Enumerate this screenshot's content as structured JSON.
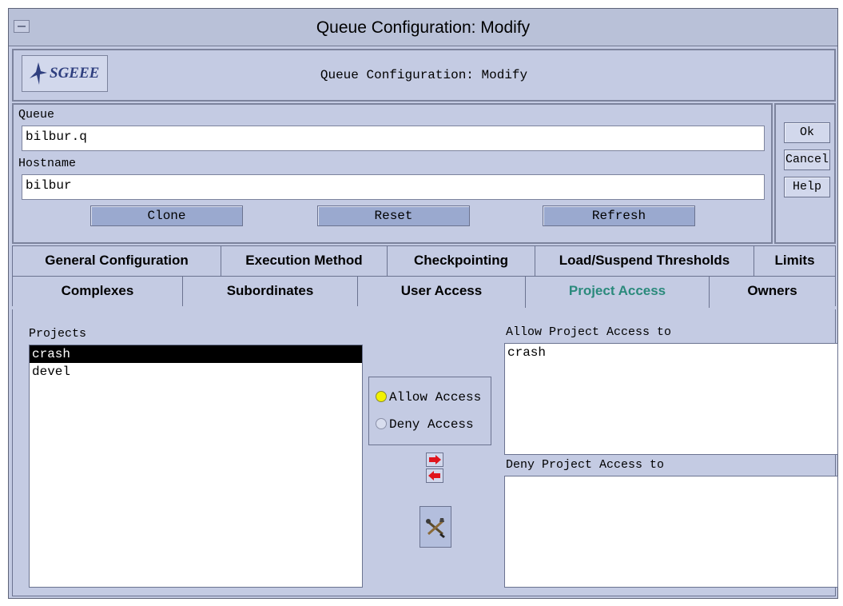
{
  "window": {
    "title": "Queue Configuration: Modify"
  },
  "header": {
    "logo_text": "SGEEE",
    "subtitle": "Queue Configuration: Modify"
  },
  "form": {
    "queue_label": "Queue",
    "queue_value": "bilbur.q",
    "hostname_label": "Hostname",
    "hostname_value": "bilbur",
    "clone_label": "Clone",
    "reset_label": "Reset",
    "refresh_label": "Refresh"
  },
  "side_buttons": {
    "ok": "Ok",
    "cancel": "Cancel",
    "help": "Help"
  },
  "tabs_row1": [
    "General Configuration",
    "Execution Method",
    "Checkpointing",
    "Load/Suspend Thresholds",
    "Limits"
  ],
  "tabs_row2": [
    "Complexes",
    "Subordinates",
    "User Access",
    "Project Access",
    "Owners"
  ],
  "active_tab": "Project Access",
  "project_access": {
    "projects_label": "Projects",
    "projects": [
      "crash",
      "devel"
    ],
    "selected_project": "crash",
    "allow_label": "Allow Access",
    "deny_label": "Deny Access",
    "allow_selected": true,
    "allow_list_label": "Allow Project Access to",
    "allow_list": [
      "crash"
    ],
    "deny_list_label": "Deny Project Access to",
    "deny_list": []
  },
  "colors": {
    "background": "#c4cbe3",
    "active_tab_text": "#2b8a7c",
    "radio_on": "#f2f200",
    "arrow": "#e0141c"
  },
  "icons": {
    "menu": "window-menu-icon",
    "logo": "bird-logo-icon",
    "add": "arrow-right-icon",
    "remove": "arrow-left-icon",
    "tool": "wrench-tool-icon"
  }
}
